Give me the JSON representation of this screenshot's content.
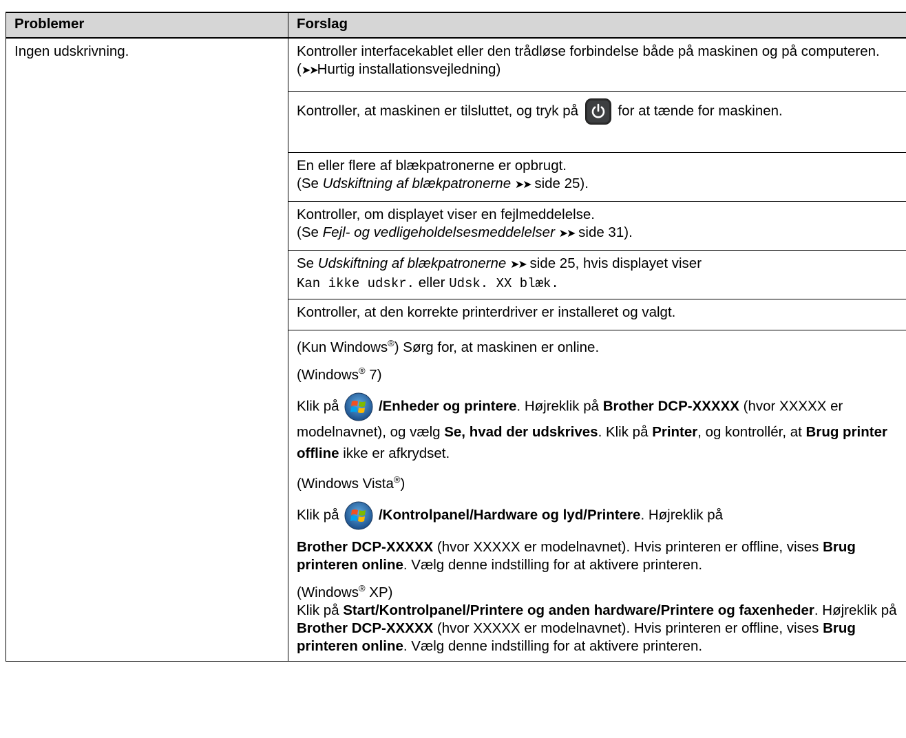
{
  "header": {
    "col_problem": "Problemer",
    "col_suggestion": "Forslag"
  },
  "problem": "Ingen udskrivning.",
  "rows": {
    "r1": {
      "text": "Kontroller interfacekablet eller den trådløse forbindelse både på maskinen og på computeren. (",
      "arrows": "➤➤",
      "link": "Hurtig installationsvejledning",
      "close": ")"
    },
    "r2": {
      "before": "Kontroller, at maskinen er tilsluttet, og tryk på",
      "after": "for at tænde for maskinen."
    },
    "r3": {
      "line1": "En eller flere af blækpatronerne er opbrugt.",
      "pre": "(Se ",
      "italic": "Udskiftning af blækpatronerne",
      "arrows": "➤➤",
      "post": " side 25)."
    },
    "r4": {
      "line1": "Kontroller, om displayet viser en fejlmeddelelse.",
      "pre": "(Se ",
      "italic": "Fejl- og vedligeholdelsesmeddelelser",
      "arrows": "➤➤",
      "post": " side 31)."
    },
    "r5": {
      "pre": "Se ",
      "italic": "Udskiftning af blækpatronerne",
      "arrows": "➤➤",
      "post": " side 25, hvis displayet viser",
      "mono1": "Kan ikke udskr.",
      "eller": "eller",
      "mono2": "Udsk. XX blæk."
    },
    "r6": {
      "text": "Kontroller, at den korrekte printerdriver er installeret og valgt."
    },
    "r7": {
      "online_pre": "(Kun Windows",
      "reg": "®",
      "online_post": ") Sørg for, at maskinen er online.",
      "w7_head_pre": "(Windows",
      "w7_head_post": " 7)",
      "w7_klik": "Klik på",
      "w7_path": "/Enheder og printere",
      "w7_hojre": ". Højreklik på ",
      "w7_brother": "Brother DCP-XXXXX",
      "w7_hvor": " (hvor XXXXX er modelnavnet), og vælg ",
      "w7_se": "Se, hvad der udskrives",
      "w7_klik2": ". Klik på ",
      "w7_printer": "Printer",
      "w7_og": ", og kontrollér, at ",
      "w7_brug": "Brug printer offline",
      "w7_ikke": " ikke er afkrydset.",
      "vista_head_pre": "(Windows Vista",
      "vista_head_post": ")",
      "vista_klik": "Klik på",
      "vista_slash1": "/",
      "vista_kontrol": "Kontrolpanel",
      "vista_slash2": "/",
      "vista_hw": "Hardware og lyd",
      "vista_slash3": "/",
      "vista_printere": "Printere",
      "vista_hojre": ". Højreklik på",
      "vista_brother": "Brother DCP-XXXXX",
      "vista_hvor": " (hvor XXXXX er modelnavnet). Hvis printeren er offline, vises ",
      "vista_brug": "Brug printeren online",
      "vista_end": ". Vælg denne indstilling for at aktivere printeren.",
      "xp_head_pre": "(Windows",
      "xp_head_post": " XP)",
      "xp_klik": "Klik på ",
      "xp_start": "Start",
      "xp_slash1": "/",
      "xp_kontrol": "Kontrolpanel",
      "xp_slash2": "/",
      "xp_phw": "Printere og anden hardware",
      "xp_slash3": "/",
      "xp_pfax": "Printere og faxenheder",
      "xp_hojre": ". Højreklik på ",
      "xp_brother": "Brother DCP-XXXXX",
      "xp_hvor": " (hvor XXXXX er modelnavnet). Hvis printeren er offline, vises ",
      "xp_brug": "Brug printeren online",
      "xp_end": ". Vælg denne indstilling for at aktivere printeren."
    }
  },
  "icons": {
    "power": "power-button-icon",
    "windows": "windows-start-orb-icon"
  }
}
